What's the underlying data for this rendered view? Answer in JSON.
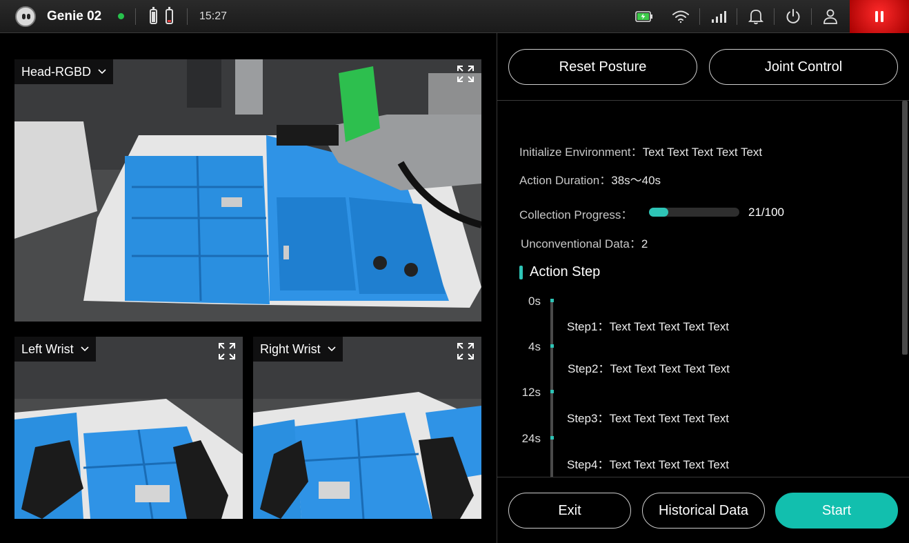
{
  "status_bar": {
    "robot_name": "Genie 02",
    "time": "15:27",
    "connection": "online",
    "icons": [
      "robot-face-icon",
      "battery-icon",
      "battery-low-icon",
      "charging-battery-icon",
      "wifi-icon",
      "signal-icon",
      "bell-icon",
      "power-icon",
      "user-icon",
      "pause-icon"
    ],
    "colors": {
      "online": "#27c24c",
      "pause_bg": "#d40000",
      "charging": "#3ecb4a"
    }
  },
  "cameras": [
    {
      "label": "Head-RGBD"
    },
    {
      "label": "Left Wrist"
    },
    {
      "label": "Right Wrist"
    }
  ],
  "controls": {
    "reset_posture": "Reset Posture",
    "joint_control": "Joint Control"
  },
  "info": {
    "init_env_label": "Initialize Environment：",
    "init_env_value": "Text Text Text Text Text",
    "duration_label": "Action Duration：",
    "duration_value": "38s～40s",
    "progress_label": "Collection Progress：",
    "progress_text": "21/100",
    "progress_fraction": 0.21,
    "unconventional_label": "Unconventional Data：",
    "unconventional_value": "2"
  },
  "action_step": {
    "title": "Action Step",
    "times": [
      "0s",
      "4s",
      "12s",
      "24s"
    ],
    "steps": [
      {
        "label": "Step1：",
        "text": "Text Text Text Text Text"
      },
      {
        "label": "Step2：",
        "text": "Text Text Text Text Text"
      },
      {
        "label": "Step3：",
        "text": "Text Text Text Text Text"
      },
      {
        "label": "Step4：",
        "text": "Text Text Text Text Text"
      }
    ]
  },
  "footer": {
    "exit": "Exit",
    "historical": "Historical Data",
    "start": "Start"
  },
  "accent_color": "#12bfae"
}
